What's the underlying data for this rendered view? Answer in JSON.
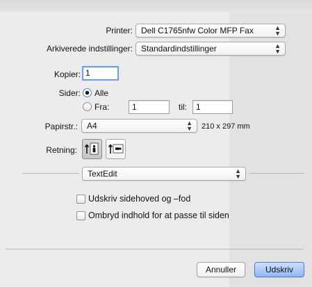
{
  "printer": {
    "label": "Printer:",
    "value": "Dell C1765nfw Color MFP Fax"
  },
  "presets": {
    "label": "Arkiverede indstillinger:",
    "value": "Standardindstillinger"
  },
  "copies": {
    "label": "Kopier:",
    "value": "1"
  },
  "pages": {
    "label": "Sider:",
    "all_label": "Alle",
    "from_label": "Fra:",
    "from_value": "1",
    "to_label": "til:",
    "to_value": "1",
    "selected": "all"
  },
  "paper": {
    "label": "Papirstr.:",
    "value": "A4",
    "size_text": "210 x 297 mm"
  },
  "orientation": {
    "label": "Retning:",
    "selected": "portrait"
  },
  "section_popup": {
    "value": "TextEdit"
  },
  "options": [
    {
      "label": "Udskriv sidehoved og –fod",
      "checked": false
    },
    {
      "label": "Ombryd indhold for at passe til siden",
      "checked": false
    }
  ],
  "buttons": {
    "cancel": "Annuller",
    "print": "Udskriv"
  },
  "colors": {
    "accent": "#4b7fd3",
    "focus_ring": "#6d9fe6"
  }
}
